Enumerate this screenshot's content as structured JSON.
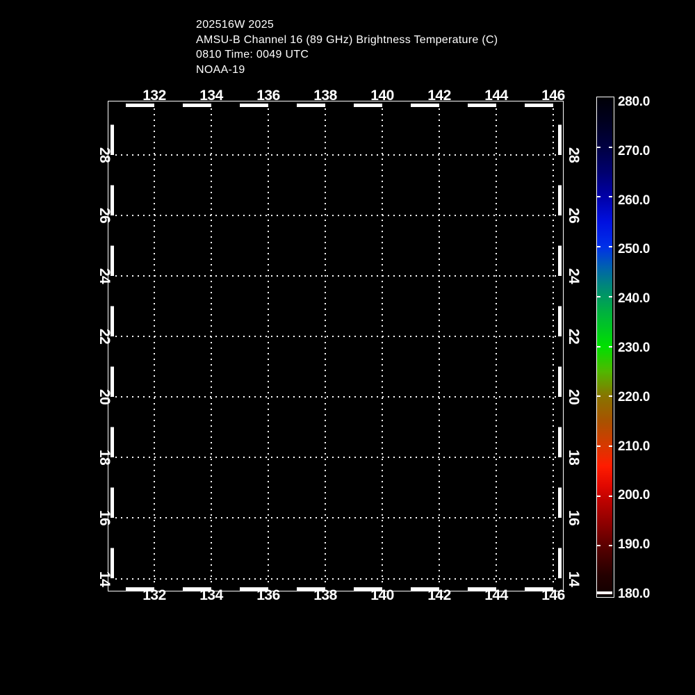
{
  "header": {
    "lines": [
      "202516W 2025",
      "AMSU-B Channel 16 (89 GHz) Brightness Temperature (C)",
      "0810 Time: 0049 UTC",
      "NOAA-19"
    ]
  },
  "map": {
    "x_ticks": [
      "132",
      "134",
      "136",
      "138",
      "140",
      "142",
      "144",
      "146"
    ],
    "y_ticks": [
      "28",
      "26",
      "24",
      "22",
      "20",
      "18",
      "16",
      "14"
    ]
  },
  "colorbar": {
    "labels": [
      "280.0",
      "270.0",
      "260.0",
      "250.0",
      "240.0",
      "230.0",
      "220.0",
      "210.0",
      "200.0",
      "190.0",
      "180.0"
    ],
    "min": 180.0,
    "max": 280.0,
    "units": "C"
  },
  "colors": {
    "background": "#000000",
    "foreground": "#ffffff"
  },
  "chart_data": {
    "type": "heatmap",
    "title": "AMSU-B Channel 16 (89 GHz) Brightness Temperature (C)",
    "annotations": [
      "202516W 2025",
      "0810 Time: 0049 UTC",
      "NOAA-19"
    ],
    "x_axis": {
      "ticks": [
        132,
        134,
        136,
        138,
        140,
        142,
        144,
        146
      ],
      "tick_interval": 2,
      "approx_range": [
        130.5,
        146.3
      ],
      "gridlines": "dotted",
      "labels_shown": "top and bottom"
    },
    "y_axis": {
      "ticks": [
        28,
        26,
        24,
        22,
        20,
        18,
        16,
        14
      ],
      "tick_interval": 2,
      "approx_range": [
        13.8,
        29.7
      ],
      "gridlines": "dotted",
      "labels_shown": "left and right, rotated 90deg"
    },
    "colorbar": {
      "orientation": "vertical",
      "position": "right",
      "min": 180.0,
      "max": 280.0,
      "tick_interval": 10.0,
      "tick_labels": [
        "280.0",
        "270.0",
        "260.0",
        "250.0",
        "240.0",
        "230.0",
        "220.0",
        "210.0",
        "200.0",
        "190.0",
        "180.0"
      ],
      "gradient_top_to_bottom": [
        "near-black navy (280)",
        "navy blue",
        "bright blue (255)",
        "teal (245)",
        "green-teal (240)",
        "bright green (230)",
        "olive (222)",
        "orange-brown (215)",
        "orange-red (210)",
        "bright red (205)",
        "red (200)",
        "dark red (190)",
        "near-black maroon (181)",
        "white cap segment (180)"
      ]
    },
    "values": [],
    "note": "map interior is empty black; no data swath rendered"
  }
}
